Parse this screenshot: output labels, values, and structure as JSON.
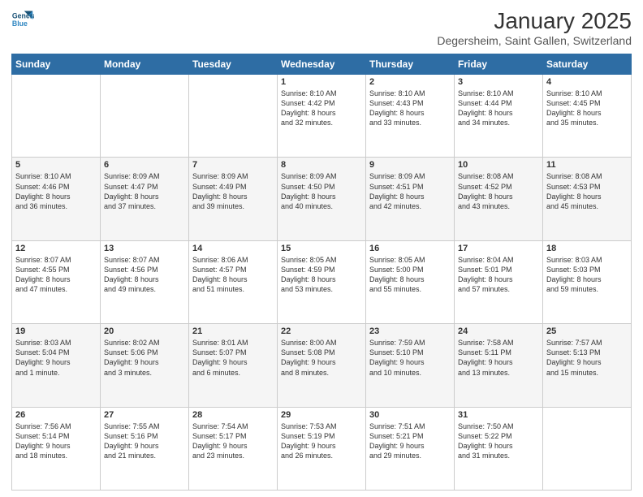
{
  "header": {
    "logo_line1": "General",
    "logo_line2": "Blue",
    "title": "January 2025",
    "subtitle": "Degersheim, Saint Gallen, Switzerland"
  },
  "weekdays": [
    "Sunday",
    "Monday",
    "Tuesday",
    "Wednesday",
    "Thursday",
    "Friday",
    "Saturday"
  ],
  "weeks": [
    [
      {
        "day": "",
        "info": ""
      },
      {
        "day": "",
        "info": ""
      },
      {
        "day": "",
        "info": ""
      },
      {
        "day": "1",
        "info": "Sunrise: 8:10 AM\nSunset: 4:42 PM\nDaylight: 8 hours\nand 32 minutes."
      },
      {
        "day": "2",
        "info": "Sunrise: 8:10 AM\nSunset: 4:43 PM\nDaylight: 8 hours\nand 33 minutes."
      },
      {
        "day": "3",
        "info": "Sunrise: 8:10 AM\nSunset: 4:44 PM\nDaylight: 8 hours\nand 34 minutes."
      },
      {
        "day": "4",
        "info": "Sunrise: 8:10 AM\nSunset: 4:45 PM\nDaylight: 8 hours\nand 35 minutes."
      }
    ],
    [
      {
        "day": "5",
        "info": "Sunrise: 8:10 AM\nSunset: 4:46 PM\nDaylight: 8 hours\nand 36 minutes."
      },
      {
        "day": "6",
        "info": "Sunrise: 8:09 AM\nSunset: 4:47 PM\nDaylight: 8 hours\nand 37 minutes."
      },
      {
        "day": "7",
        "info": "Sunrise: 8:09 AM\nSunset: 4:49 PM\nDaylight: 8 hours\nand 39 minutes."
      },
      {
        "day": "8",
        "info": "Sunrise: 8:09 AM\nSunset: 4:50 PM\nDaylight: 8 hours\nand 40 minutes."
      },
      {
        "day": "9",
        "info": "Sunrise: 8:09 AM\nSunset: 4:51 PM\nDaylight: 8 hours\nand 42 minutes."
      },
      {
        "day": "10",
        "info": "Sunrise: 8:08 AM\nSunset: 4:52 PM\nDaylight: 8 hours\nand 43 minutes."
      },
      {
        "day": "11",
        "info": "Sunrise: 8:08 AM\nSunset: 4:53 PM\nDaylight: 8 hours\nand 45 minutes."
      }
    ],
    [
      {
        "day": "12",
        "info": "Sunrise: 8:07 AM\nSunset: 4:55 PM\nDaylight: 8 hours\nand 47 minutes."
      },
      {
        "day": "13",
        "info": "Sunrise: 8:07 AM\nSunset: 4:56 PM\nDaylight: 8 hours\nand 49 minutes."
      },
      {
        "day": "14",
        "info": "Sunrise: 8:06 AM\nSunset: 4:57 PM\nDaylight: 8 hours\nand 51 minutes."
      },
      {
        "day": "15",
        "info": "Sunrise: 8:05 AM\nSunset: 4:59 PM\nDaylight: 8 hours\nand 53 minutes."
      },
      {
        "day": "16",
        "info": "Sunrise: 8:05 AM\nSunset: 5:00 PM\nDaylight: 8 hours\nand 55 minutes."
      },
      {
        "day": "17",
        "info": "Sunrise: 8:04 AM\nSunset: 5:01 PM\nDaylight: 8 hours\nand 57 minutes."
      },
      {
        "day": "18",
        "info": "Sunrise: 8:03 AM\nSunset: 5:03 PM\nDaylight: 8 hours\nand 59 minutes."
      }
    ],
    [
      {
        "day": "19",
        "info": "Sunrise: 8:03 AM\nSunset: 5:04 PM\nDaylight: 9 hours\nand 1 minute."
      },
      {
        "day": "20",
        "info": "Sunrise: 8:02 AM\nSunset: 5:06 PM\nDaylight: 9 hours\nand 3 minutes."
      },
      {
        "day": "21",
        "info": "Sunrise: 8:01 AM\nSunset: 5:07 PM\nDaylight: 9 hours\nand 6 minutes."
      },
      {
        "day": "22",
        "info": "Sunrise: 8:00 AM\nSunset: 5:08 PM\nDaylight: 9 hours\nand 8 minutes."
      },
      {
        "day": "23",
        "info": "Sunrise: 7:59 AM\nSunset: 5:10 PM\nDaylight: 9 hours\nand 10 minutes."
      },
      {
        "day": "24",
        "info": "Sunrise: 7:58 AM\nSunset: 5:11 PM\nDaylight: 9 hours\nand 13 minutes."
      },
      {
        "day": "25",
        "info": "Sunrise: 7:57 AM\nSunset: 5:13 PM\nDaylight: 9 hours\nand 15 minutes."
      }
    ],
    [
      {
        "day": "26",
        "info": "Sunrise: 7:56 AM\nSunset: 5:14 PM\nDaylight: 9 hours\nand 18 minutes."
      },
      {
        "day": "27",
        "info": "Sunrise: 7:55 AM\nSunset: 5:16 PM\nDaylight: 9 hours\nand 21 minutes."
      },
      {
        "day": "28",
        "info": "Sunrise: 7:54 AM\nSunset: 5:17 PM\nDaylight: 9 hours\nand 23 minutes."
      },
      {
        "day": "29",
        "info": "Sunrise: 7:53 AM\nSunset: 5:19 PM\nDaylight: 9 hours\nand 26 minutes."
      },
      {
        "day": "30",
        "info": "Sunrise: 7:51 AM\nSunset: 5:21 PM\nDaylight: 9 hours\nand 29 minutes."
      },
      {
        "day": "31",
        "info": "Sunrise: 7:50 AM\nSunset: 5:22 PM\nDaylight: 9 hours\nand 31 minutes."
      },
      {
        "day": "",
        "info": ""
      }
    ]
  ]
}
